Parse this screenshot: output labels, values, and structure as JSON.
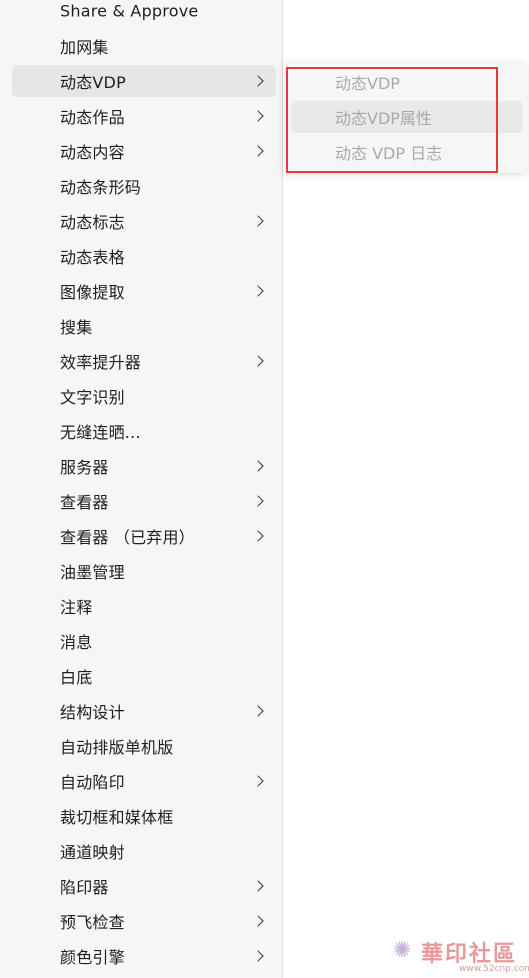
{
  "menu": {
    "items": [
      {
        "label": "Share & Approve",
        "submenu": false,
        "highlighted": false
      },
      {
        "label": "加网集",
        "submenu": false,
        "highlighted": false
      },
      {
        "label": "动态VDP",
        "submenu": true,
        "highlighted": true
      },
      {
        "label": "动态作品",
        "submenu": true,
        "highlighted": false
      },
      {
        "label": "动态内容",
        "submenu": true,
        "highlighted": false
      },
      {
        "label": "动态条形码",
        "submenu": false,
        "highlighted": false
      },
      {
        "label": "动态标志",
        "submenu": true,
        "highlighted": false
      },
      {
        "label": "动态表格",
        "submenu": false,
        "highlighted": false
      },
      {
        "label": "图像提取",
        "submenu": true,
        "highlighted": false
      },
      {
        "label": "搜集",
        "submenu": false,
        "highlighted": false
      },
      {
        "label": "效率提升器",
        "submenu": true,
        "highlighted": false
      },
      {
        "label": "文字识别",
        "submenu": false,
        "highlighted": false
      },
      {
        "label": "无缝连晒...",
        "submenu": false,
        "highlighted": false
      },
      {
        "label": "服务器",
        "submenu": true,
        "highlighted": false
      },
      {
        "label": "查看器",
        "submenu": true,
        "highlighted": false
      },
      {
        "label": "查看器 （已弃用）",
        "submenu": true,
        "highlighted": false
      },
      {
        "label": "油墨管理",
        "submenu": false,
        "highlighted": false
      },
      {
        "label": "注释",
        "submenu": false,
        "highlighted": false
      },
      {
        "label": "消息",
        "submenu": false,
        "highlighted": false
      },
      {
        "label": "白底",
        "submenu": false,
        "highlighted": false
      },
      {
        "label": "结构设计",
        "submenu": true,
        "highlighted": false
      },
      {
        "label": "自动排版单机版",
        "submenu": false,
        "highlighted": false
      },
      {
        "label": "自动陷印",
        "submenu": true,
        "highlighted": false
      },
      {
        "label": "裁切框和媒体框",
        "submenu": false,
        "highlighted": false
      },
      {
        "label": "通道映射",
        "submenu": false,
        "highlighted": false
      },
      {
        "label": "陷印器",
        "submenu": true,
        "highlighted": false
      },
      {
        "label": "预飞检查",
        "submenu": true,
        "highlighted": false
      },
      {
        "label": "颜色引擎",
        "submenu": true,
        "highlighted": false
      }
    ]
  },
  "submenu": {
    "items": [
      {
        "label": "动态VDP",
        "disabled": true,
        "hovered": false
      },
      {
        "label": "动态VDP属性",
        "disabled": true,
        "hovered": true
      },
      {
        "label": "动态 VDP 日志",
        "disabled": true,
        "hovered": false
      }
    ]
  },
  "watermark": {
    "title": "華印社區",
    "url": "www.52cnp.com"
  },
  "colors": {
    "menu_bg": "#f6f6f6",
    "highlight_bg": "#e6e6e6",
    "disabled_text": "#a9a9a9",
    "annotation_red": "#e2393c"
  }
}
